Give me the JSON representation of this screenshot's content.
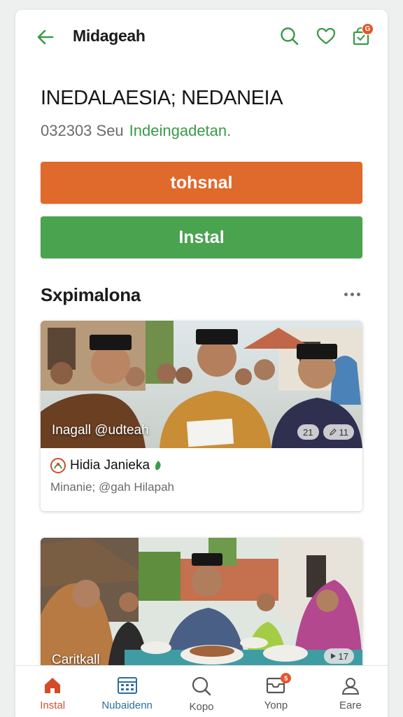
{
  "header": {
    "title": "Midageah",
    "icons": [
      "back-arrow-icon",
      "search-icon",
      "heart-icon",
      "bag-icon"
    ],
    "bag_badge": "G"
  },
  "hero": {
    "headline": "INEDALAESIA; NEDANEIA",
    "meta": "032303 Seu",
    "link": "Indeingadetan."
  },
  "buttons": {
    "primary_label": "tohsnal",
    "secondary_label": "Instal"
  },
  "section": {
    "title": "Sxpimalona"
  },
  "feed": [
    {
      "caption": "Inagall @udteah",
      "chips": [
        "21",
        "11"
      ],
      "author": "Hidia Janieka",
      "subtitle": "Minanie; @gah Hilapah"
    },
    {
      "caption": "Caritkall",
      "chips": [
        "17"
      ]
    }
  ],
  "bottom_nav": [
    {
      "label": "Instal",
      "icon": "home-icon"
    },
    {
      "label": "Nubaidenn",
      "icon": "calendar-grid-icon"
    },
    {
      "label": "Kopo",
      "icon": "search-icon"
    },
    {
      "label": "Yonp",
      "icon": "inbox-icon",
      "badge": "5"
    },
    {
      "label": "Eare",
      "icon": "profile-icon"
    }
  ],
  "colors": {
    "accent_orange": "#e0692c",
    "accent_green": "#4aa34f",
    "link_green": "#3a9a48",
    "badge": "#e2572a"
  }
}
